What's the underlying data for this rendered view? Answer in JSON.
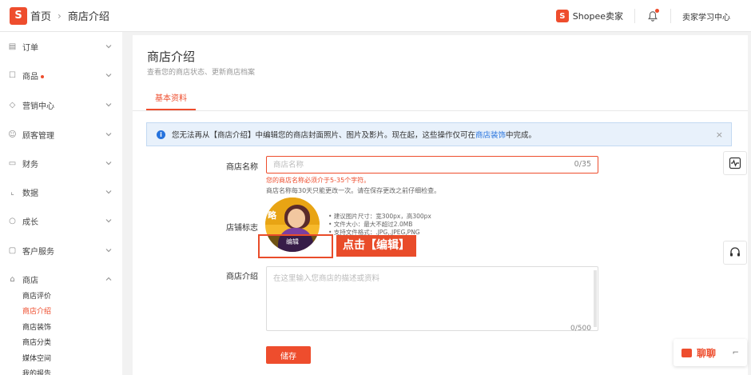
{
  "header": {
    "logo_letter": "S",
    "breadcrumb_home": "首页",
    "breadcrumb_sep": "›",
    "breadcrumb_current": "商店介绍",
    "brand_logo_letter": "S",
    "brand_text": "Shopee卖家",
    "learning_center": "卖家学习中心"
  },
  "sidebar": {
    "items": [
      {
        "label": "订单",
        "icon": "clipboard-icon"
      },
      {
        "label": "商品",
        "icon": "box-icon"
      },
      {
        "label": "营销中心",
        "icon": "tag-icon"
      },
      {
        "label": "顾客管理",
        "icon": "customers-icon"
      },
      {
        "label": "财务",
        "icon": "wallet-icon"
      },
      {
        "label": "数据",
        "icon": "chart-icon"
      },
      {
        "label": "成长",
        "icon": "badge-icon"
      },
      {
        "label": "客户服务",
        "icon": "message-icon"
      },
      {
        "label": "商店",
        "icon": "store-icon"
      }
    ],
    "shop_sub": [
      "商店评价",
      "商店介绍",
      "商店装饰",
      "商店分类",
      "媒体空间",
      "我的报告"
    ]
  },
  "main": {
    "title": "商店介绍",
    "subtitle": "查看您的商店状态、更新商店档案",
    "tab": "基本资料",
    "notice_prefix": "您无法再从【商店介绍】中编辑您的商店封面照片、图片及影片。现在起，这些操作仅可在",
    "notice_link": "商店装饰",
    "notice_suffix": "中完成。",
    "notice_close": "×",
    "shop_name_label": "商店名称",
    "shop_name_placeholder": "商店名称",
    "shop_name_counter": "0/35",
    "shop_name_error": "您的商店名称必须介于5-35个字符。",
    "shop_name_hint": "商店名称每30天只能更改一次。请在保存更改之前仔细检查。",
    "logo_label": "店铺标志",
    "logo_badge_text": "略",
    "logo_edit": "编辑",
    "logo_specs": [
      "• 建议图片尺寸：宽300px，高300px",
      "• 文件大小：最大不超过2.0MB",
      "• 支持文件格式：.JPG,.JPEG,PNG"
    ],
    "callout": "点击【编辑】",
    "desc_label": "商店介绍",
    "desc_placeholder": "在这里输入您商店的描述或资料",
    "desc_counter": "0/500",
    "save_button": "储存"
  },
  "floating": {
    "chat_label": "聊聊"
  },
  "colors": {
    "accent": "#ee4d2d",
    "notice_bg": "#e8f1fb",
    "link": "#2673dd"
  }
}
